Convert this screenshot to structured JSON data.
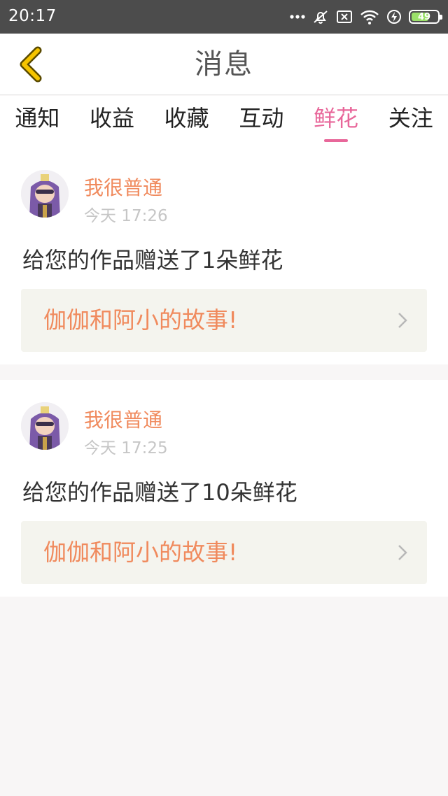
{
  "status": {
    "time": "20:17",
    "battery": "49"
  },
  "header": {
    "title": "消息"
  },
  "tabs": [
    {
      "label": "通知"
    },
    {
      "label": "收益"
    },
    {
      "label": "收藏"
    },
    {
      "label": "互动"
    },
    {
      "label": "鲜花",
      "active": true
    },
    {
      "label": "关注"
    }
  ],
  "messages": [
    {
      "user": "我很普通",
      "time": "今天 17:26",
      "text": "给您的作品赠送了1朵鲜花",
      "work": "伽伽和阿小的故事!"
    },
    {
      "user": "我很普通",
      "time": "今天 17:25",
      "text": "给您的作品赠送了10朵鲜花",
      "work": "伽伽和阿小的故事!"
    }
  ],
  "colors": {
    "accent": "#e8679a",
    "orange": "#f08a5d",
    "back_arrow": "#f5c400",
    "statusbar": "#4c4c4c"
  }
}
